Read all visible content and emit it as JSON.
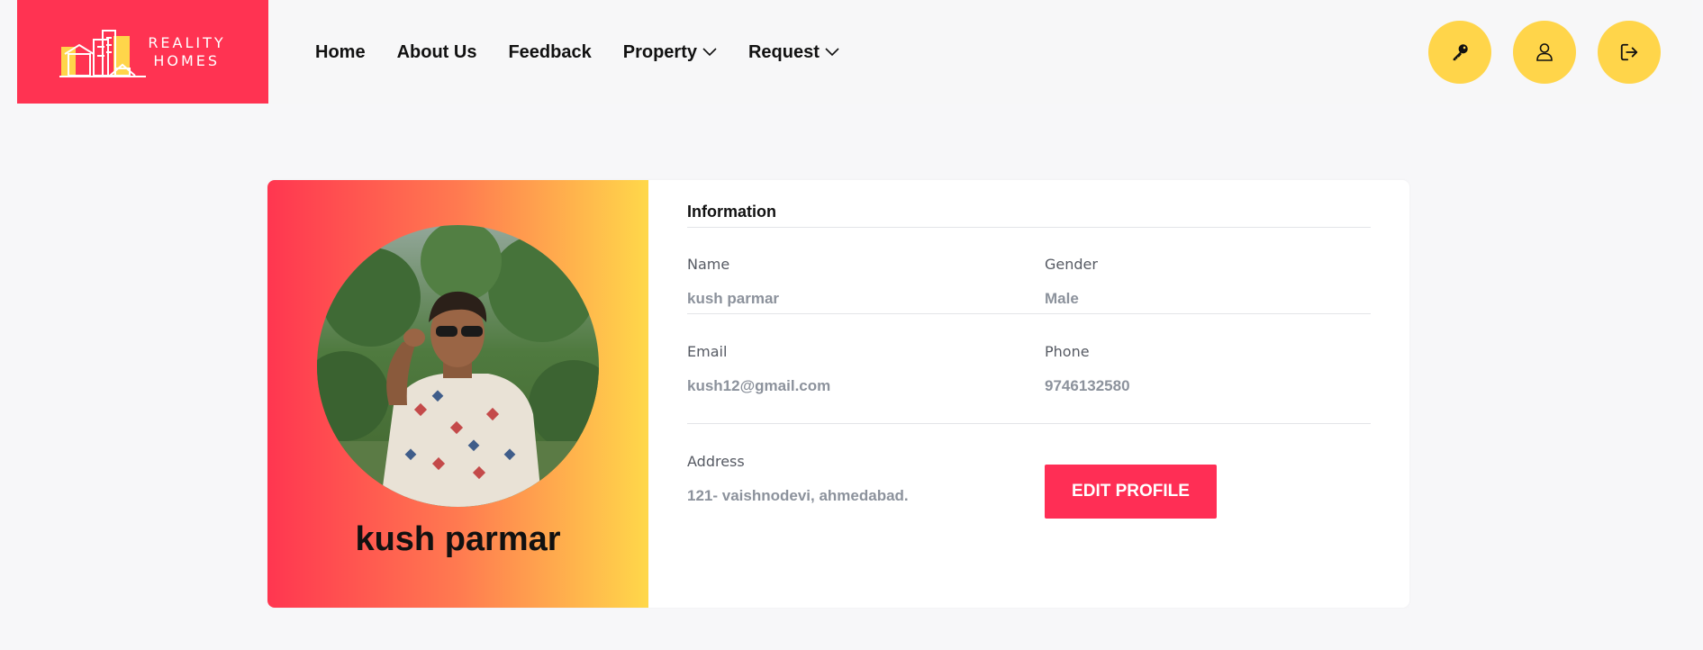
{
  "brand": {
    "line1": "REALITY",
    "line2": "HOMES"
  },
  "nav": {
    "home": "Home",
    "about": "About Us",
    "feedback": "Feedback",
    "property": "Property",
    "request": "Request"
  },
  "header_actions": [
    "key-icon",
    "user-icon",
    "logout-icon"
  ],
  "profile": {
    "name": "kush parmar",
    "info_title": "Information",
    "fields": {
      "name_label": "Name",
      "name_value": "kush parmar",
      "gender_label": "Gender",
      "gender_value": "Male",
      "email_label": "Email",
      "email_value": "kush12@gmail.com",
      "phone_label": "Phone",
      "phone_value": "9746132580",
      "address_label": "Address",
      "address_value": "121- vaishnodevi, ahmedabad."
    },
    "edit_label": "EDIT PROFILE"
  },
  "colors": {
    "brand_red": "#ff3352",
    "accent_yellow": "#ffd54a",
    "button_red": "#ff2e55",
    "gradient_start": "#ff3650",
    "gradient_end": "#ffd84a"
  }
}
